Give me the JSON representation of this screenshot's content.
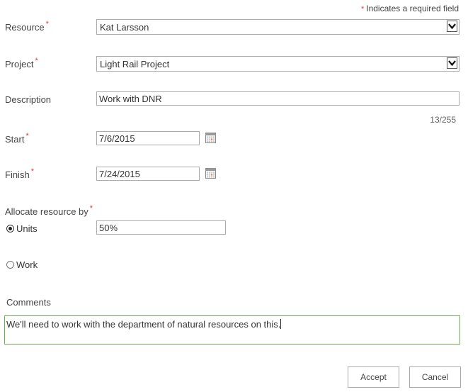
{
  "required_note": {
    "star": "*",
    "text": "Indicates a required field"
  },
  "form": {
    "resource": {
      "label": "Resource",
      "value": "Kat Larsson"
    },
    "project": {
      "label": "Project",
      "value": "Light Rail Project"
    },
    "description": {
      "label": "Description",
      "value": "Work with DNR",
      "counter": "13/255"
    },
    "start": {
      "label": "Start",
      "value": "7/6/2015",
      "icon": "calendar-icon"
    },
    "finish": {
      "label": "Finish",
      "value": "7/24/2015",
      "icon": "calendar-icon"
    },
    "allocate": {
      "label": "Allocate resource by",
      "units": {
        "label": "Units",
        "value": "50%",
        "selected": true
      },
      "work": {
        "label": "Work",
        "selected": false
      }
    },
    "comments": {
      "label": "Comments",
      "value": "We'll need to work with the department of natural resources on this."
    }
  },
  "required_star": "*",
  "buttons": {
    "accept": "Accept",
    "cancel": "Cancel"
  },
  "colors": {
    "required": "#e5383b",
    "focus_border": "#69b14f",
    "border": "#ababab"
  }
}
